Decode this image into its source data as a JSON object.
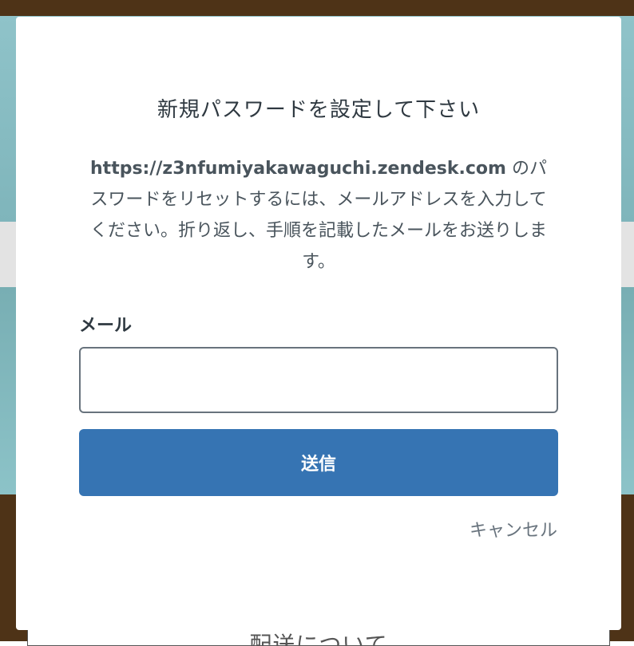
{
  "background": {
    "bottom_card_text": "配送について"
  },
  "modal": {
    "title": "新規パスワードを設定して下さい",
    "description_url": "https://z3nfumiyakawaguchi.zendesk.com",
    "description_text": " のパスワードをリセットするには、メールアドレスを入力してください。折り返し、手順を記載したメールをお送りします。",
    "email_label": "メール",
    "email_value": "",
    "submit_label": "送信",
    "cancel_label": "キャンセル"
  },
  "colors": {
    "accent": "#3674b3",
    "background_brown": "#4e3317",
    "background_teal": "#8fc3c9",
    "text_primary": "#2f3941",
    "text_secondary": "#68737d"
  }
}
